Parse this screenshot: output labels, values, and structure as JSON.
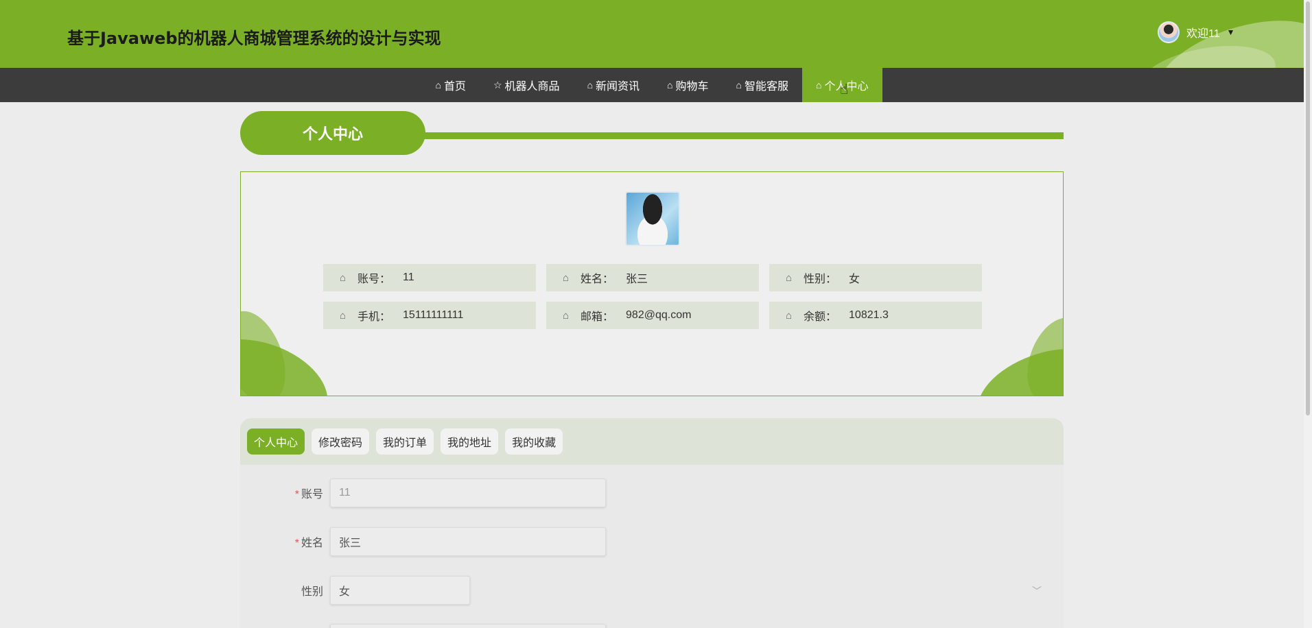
{
  "header": {
    "title": "基于Javaweb的机器人商城管理系统的设计与实现",
    "welcome": "欢迎11",
    "caret_icon": "caret-down-icon",
    "avatar_icon": "user-avatar"
  },
  "nav": {
    "items": [
      {
        "label": "首页",
        "icon": "home-icon"
      },
      {
        "label": "机器人商品",
        "icon": "star-icon"
      },
      {
        "label": "新闻资讯",
        "icon": "bag-icon"
      },
      {
        "label": "购物车",
        "icon": "home-icon"
      },
      {
        "label": "智能客服",
        "icon": "home-icon"
      },
      {
        "label": "个人中心",
        "icon": "home-icon",
        "active": true
      }
    ]
  },
  "section": {
    "title": "个人中心"
  },
  "profile": {
    "fields": [
      {
        "label": "账号：",
        "value": "11"
      },
      {
        "label": "姓名：",
        "value": "张三"
      },
      {
        "label": "性别：",
        "value": "女"
      },
      {
        "label": "手机：",
        "value": "15111111111"
      },
      {
        "label": "邮箱：",
        "value": "982@qq.com"
      },
      {
        "label": "余额：",
        "value": "10821.3"
      }
    ]
  },
  "tabs": [
    {
      "label": "个人中心",
      "active": true
    },
    {
      "label": "修改密码"
    },
    {
      "label": "我的订单"
    },
    {
      "label": "我的地址"
    },
    {
      "label": "我的收藏"
    }
  ],
  "form": {
    "account": {
      "label": "账号",
      "required": "*",
      "value": "11"
    },
    "name": {
      "label": "姓名",
      "required": "*",
      "value": "张三"
    },
    "gender": {
      "label": "性别",
      "value": "女"
    }
  },
  "colors": {
    "accent": "#7bb026",
    "nav_bg": "#3c3c3c",
    "info_bg": "#dde3d6"
  }
}
